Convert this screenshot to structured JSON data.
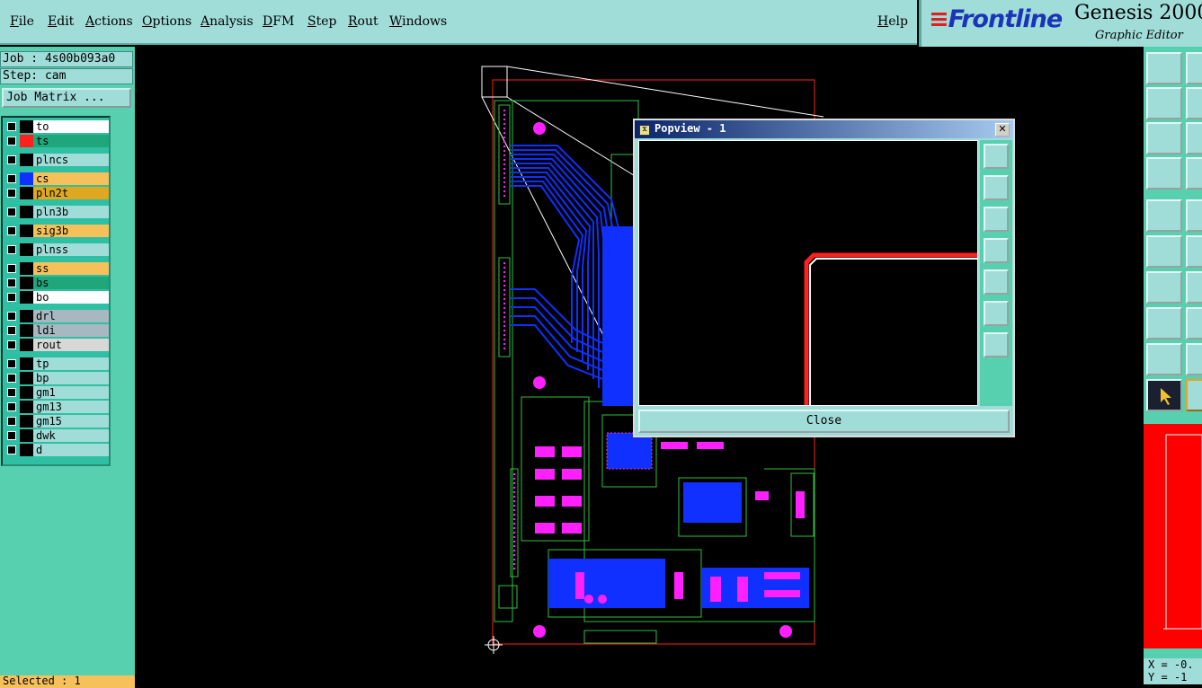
{
  "menu": {
    "file": "File",
    "edit": "Edit",
    "actions": "Actions",
    "options": "Options",
    "analysis": "Analysis",
    "dfm": "DFM",
    "step": "Step",
    "rout": "Rout",
    "windows": "Windows",
    "help": "Help"
  },
  "logo": {
    "brand": "Frontline",
    "product": "Genesis 2000",
    "subtitle": "Graphic Editor"
  },
  "info": {
    "job": "Job : 4s00b093a0",
    "step": "Step: cam",
    "job_matrix": "Job Matrix ..."
  },
  "layers": [
    {
      "name": "to",
      "swatch": "#000000",
      "bg": "#ffffff"
    },
    {
      "name": "ts",
      "swatch": "#ff2020",
      "bg": "#1fa67a"
    },
    {
      "name": "plncs",
      "swatch": "#000000",
      "bg": "#a0dcd8"
    },
    {
      "name": "cs",
      "swatch": "#1030ff",
      "bg": "#f6c15a"
    },
    {
      "name": "pln2t",
      "swatch": "#000000",
      "bg": "#e0a820"
    },
    {
      "name": "pln3b",
      "swatch": "#000000",
      "bg": "#a0dcd8"
    },
    {
      "name": "sig3b",
      "swatch": "#000000",
      "bg": "#f6c15a"
    },
    {
      "name": "plnss",
      "swatch": "#000000",
      "bg": "#a0dcd8"
    },
    {
      "name": "ss",
      "swatch": "#000000",
      "bg": "#f6c15a"
    },
    {
      "name": "bs",
      "swatch": "#000000",
      "bg": "#1fa67a"
    },
    {
      "name": "bo",
      "swatch": "#000000",
      "bg": "#ffffff"
    },
    {
      "name": "drl",
      "swatch": "#000000",
      "bg": "#a8b8c0"
    },
    {
      "name": "ldi",
      "swatch": "#000000",
      "bg": "#a8b8c0"
    },
    {
      "name": "rout",
      "swatch": "#000000",
      "bg": "#d8d8d8"
    },
    {
      "name": "tp",
      "swatch": "#000000",
      "bg": "#a0dcd8"
    },
    {
      "name": "bp",
      "swatch": "#000000",
      "bg": "#a0dcd8"
    },
    {
      "name": "gm1",
      "swatch": "#000000",
      "bg": "#a0dcd8"
    },
    {
      "name": "gm13",
      "swatch": "#000000",
      "bg": "#a0dcd8"
    },
    {
      "name": "gm15",
      "swatch": "#000000",
      "bg": "#a0dcd8"
    },
    {
      "name": "dwk",
      "swatch": "#000000",
      "bg": "#a0dcd8"
    },
    {
      "name": "d",
      "swatch": "#000000",
      "bg": "#a0dcd8"
    }
  ],
  "status": {
    "selected": "Selected : 1",
    "x": "X = -0.",
    "y": "Y = -1"
  },
  "popview": {
    "title": "Popview - 1",
    "close_label": "Close"
  },
  "colors": {
    "panel": "#a0dcd8",
    "panel_dark": "#57d0b0",
    "signal": "#1030ff",
    "pad": "#ff20ff",
    "outline": "#2fbf40",
    "profile": "#ff2020"
  }
}
